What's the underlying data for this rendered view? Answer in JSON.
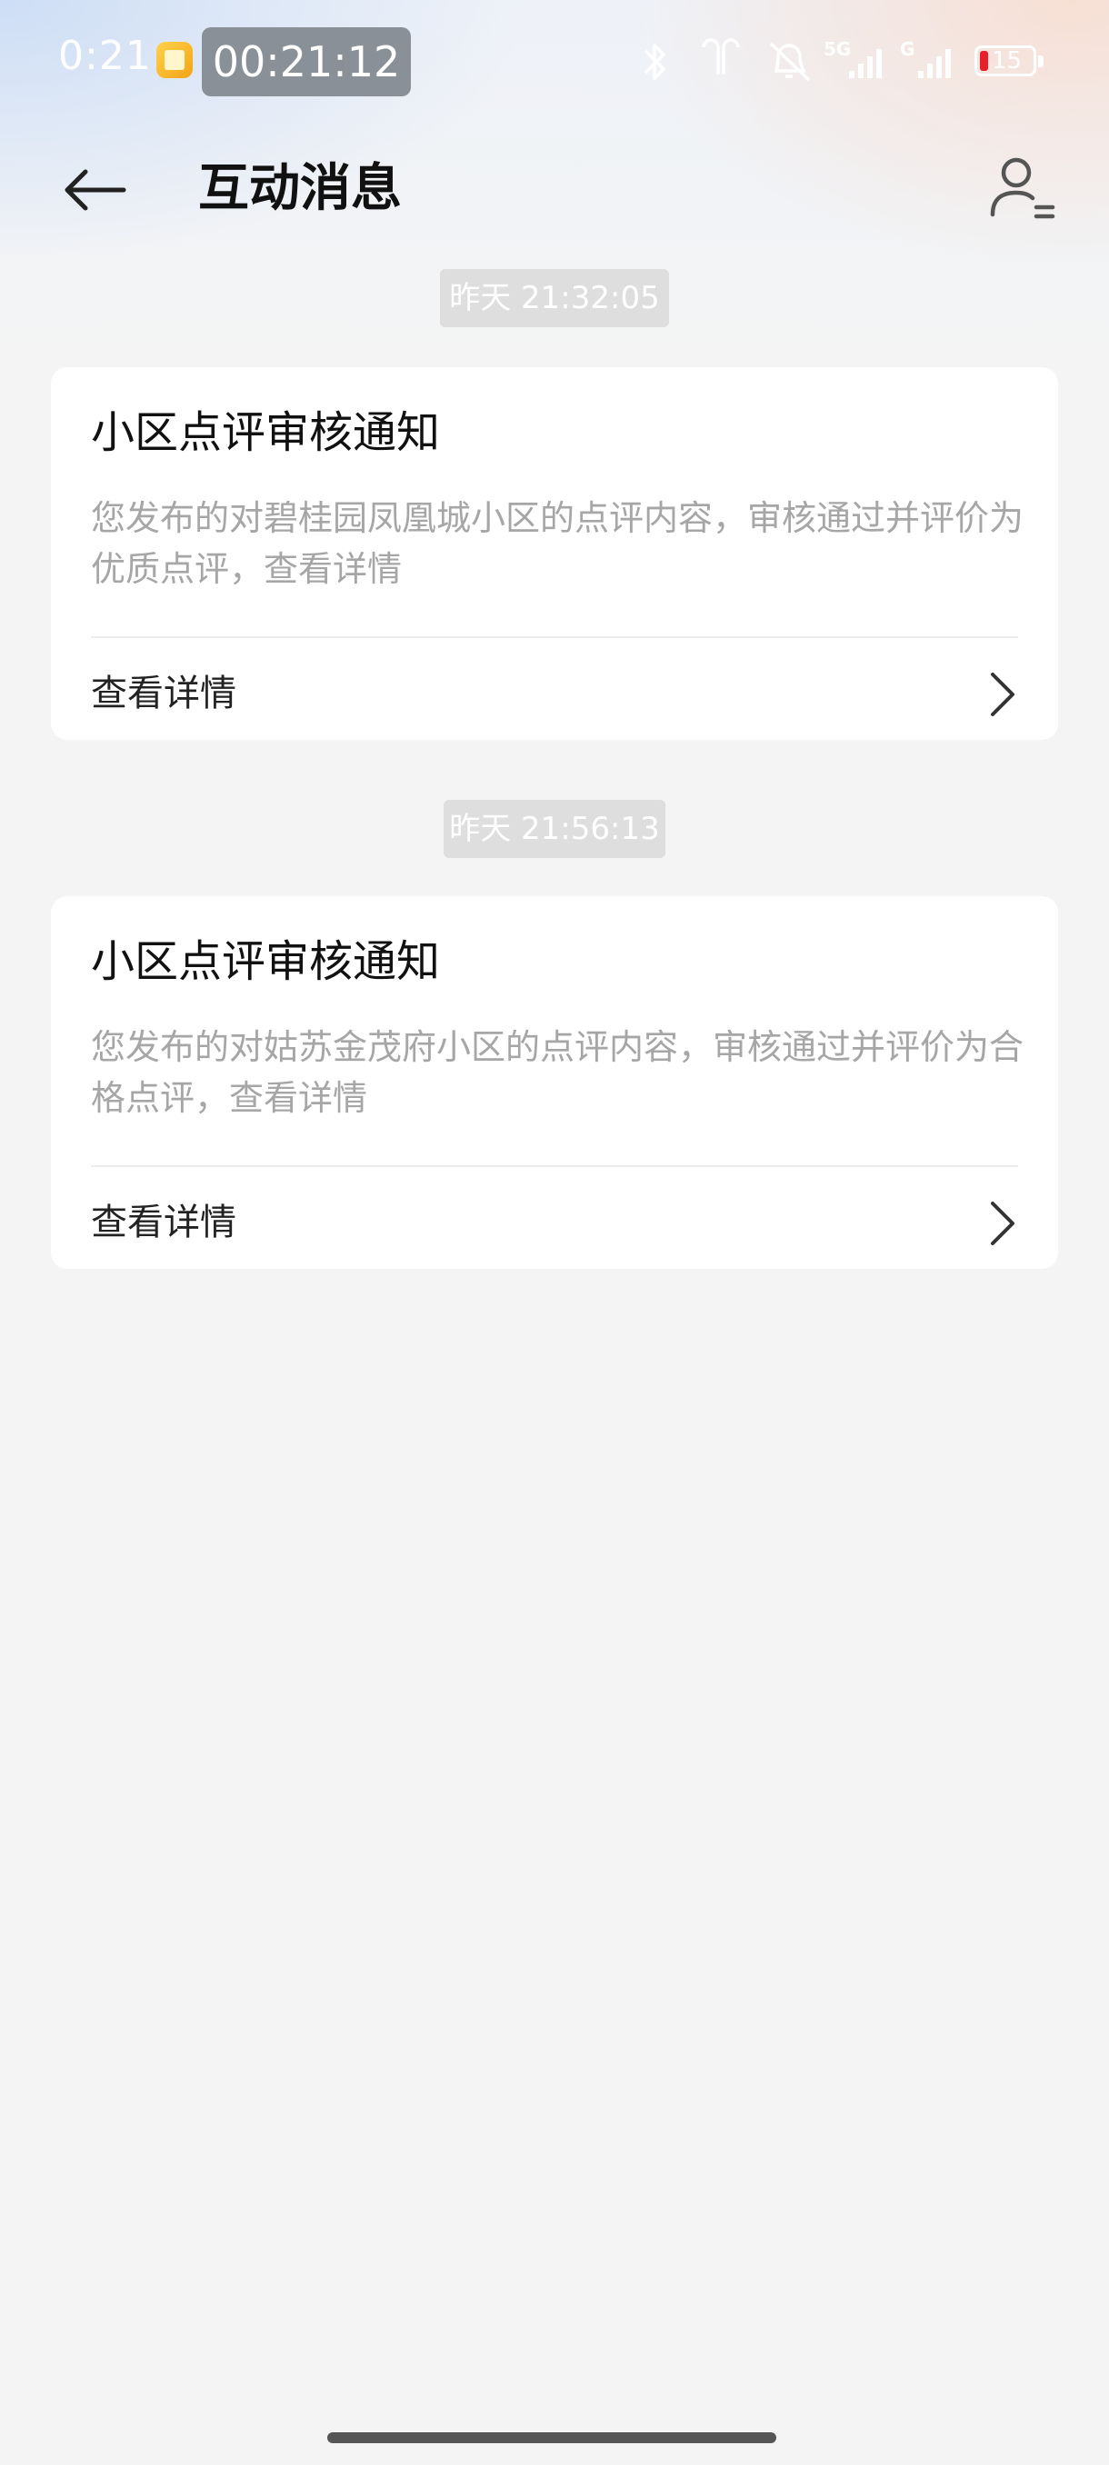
{
  "status_bar": {
    "time": "0:21",
    "recording_timer": "00:21:12",
    "battery_level": "15",
    "network_label": "5G",
    "network_label2": "G",
    "icons": [
      "app-notification-icon",
      "bluetooth-icon",
      "earbuds-icon",
      "mute-icon",
      "signal-5g-icon",
      "signal-icon",
      "battery-icon"
    ]
  },
  "header": {
    "title": "互动消息",
    "back_icon": "arrow-left-icon",
    "profile_icon": "user-settings-icon"
  },
  "messages": [
    {
      "timestamp": "昨天 21:32:05",
      "title": "小区点评审核通知",
      "body": "您发布的对碧桂园凤凰城小区的点评内容，审核通过并评价为优质点评，查看详情",
      "link_label": "查看详情"
    },
    {
      "timestamp": "昨天 21:56:13",
      "title": "小区点评审核通知",
      "body": "您发布的对姑苏金茂府小区的点评内容，审核通过并评价为合格点评，查看详情",
      "link_label": "查看详情"
    }
  ],
  "colors": {
    "page_bg": "#f4f4f4",
    "card_bg": "#ffffff",
    "timestamp_bg": "#dedede",
    "body_text": "#a6a6a6",
    "battery_low": "#e8202a"
  }
}
